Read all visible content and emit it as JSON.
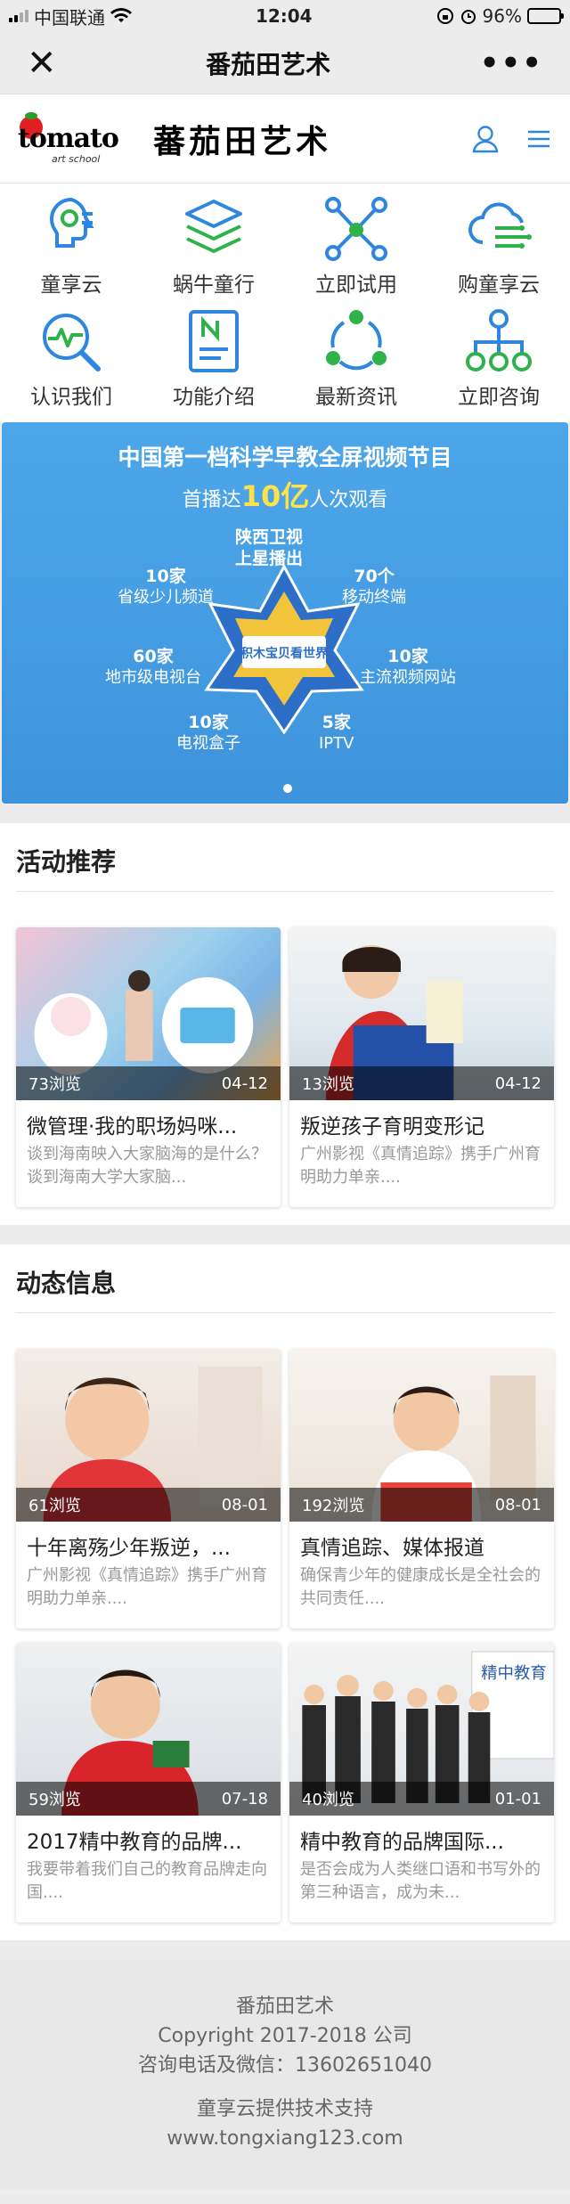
{
  "status_bar": {
    "carrier": "中国联通",
    "time": "12:04",
    "battery": "96%",
    "battery_level": 0.96
  },
  "nav": {
    "title": "番茄田艺术"
  },
  "header": {
    "logo_text": "tomato",
    "logo_sub": "art school",
    "logo_cn": "蕃茄田艺术"
  },
  "grid": [
    {
      "label": "童享云",
      "icon": "head-gear-icon"
    },
    {
      "label": "蜗牛童行",
      "icon": "layers-icon"
    },
    {
      "label": "立即试用",
      "icon": "network-icon"
    },
    {
      "label": "购童享云",
      "icon": "cloud-icon"
    },
    {
      "label": "认识我们",
      "icon": "magnifier-pulse-icon"
    },
    {
      "label": "功能介绍",
      "icon": "document-icon"
    },
    {
      "label": "最新资讯",
      "icon": "triangle-nodes-icon"
    },
    {
      "label": "立即咨询",
      "icon": "hierarchy-icon"
    }
  ],
  "banner": {
    "title": "中国第一档科学早教全屏视频节目",
    "sub_prefix": "首播达",
    "sub_highlight": "10亿",
    "sub_suffix": "人次观看",
    "center_label": "积木宝贝看世界",
    "labels": [
      {
        "n": "陕西卫视",
        "t": "上星播出"
      },
      {
        "n": "10家",
        "t": "省级少儿频道"
      },
      {
        "n": "70个",
        "t": "移动终端"
      },
      {
        "n": "60家",
        "t": "地市级电视台"
      },
      {
        "n": "10家",
        "t": "主流视频网站"
      },
      {
        "n": "10家",
        "t": "电视盒子"
      },
      {
        "n": "5家",
        "t": "IPTV"
      }
    ]
  },
  "activity": {
    "title": "活动推荐",
    "cards": [
      {
        "views": "73浏览",
        "date": "04-12",
        "title": "微管理·我的职场妈咪...",
        "desc": "谈到海南映入大家脑海的是什么？谈到海南大学大家脑..."
      },
      {
        "views": "13浏览",
        "date": "04-12",
        "title": "叛逆孩子育明变形记",
        "desc": "广州影视《真情追踪》携手广州育明助力单亲...."
      }
    ]
  },
  "news": {
    "title": "动态信息",
    "cards": [
      {
        "views": "61浏览",
        "date": "08-01",
        "title": "十年离殇少年叛逆，...",
        "desc": "广州影视《真情追踪》携手广州育明助力单亲...."
      },
      {
        "views": "192浏览",
        "date": "08-01",
        "title": "真情追踪、媒体报道",
        "desc": "确保青少年的健康成长是全社会的共同责任...."
      },
      {
        "views": "59浏览",
        "date": "07-18",
        "title": "2017精中教育的品牌...",
        "desc": "我要带着我们自己的教育品牌走向国...."
      },
      {
        "views": "40浏览",
        "date": "01-01",
        "title": "精中教育的品牌国际...",
        "desc": "是否会成为人类继口语和书写外的第三种语言，成为未..."
      }
    ]
  },
  "footer": {
    "name": "番茄田艺术",
    "copyright": "Copyright 2017-2018 公司",
    "contact": "咨询电话及微信：13602651040",
    "support": "童享云提供技术支持",
    "website": "www.tongxiang123.com"
  },
  "colors": {
    "accent": "#2e86de",
    "green": "#2fb24a",
    "banner": "#4ea6ea"
  }
}
